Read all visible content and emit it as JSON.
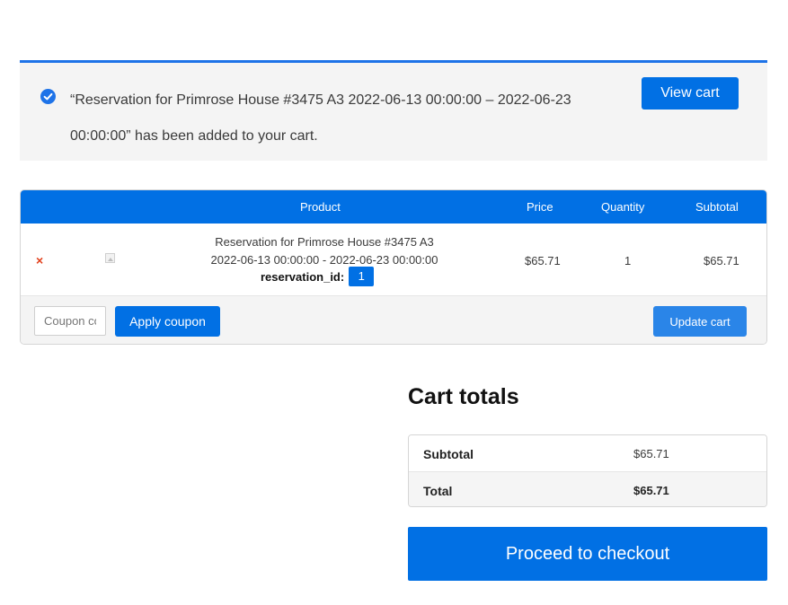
{
  "notice": {
    "message": "“Reservation for Primrose House #3475 A3 2022-06-13 00:00:00 – 2022-06-23 00:00:00” has been added to your cart.",
    "view_cart_label": "View cart",
    "icon": "check-circle-icon"
  },
  "cart_table": {
    "headers": {
      "product": "Product",
      "price": "Price",
      "quantity": "Quantity",
      "subtotal": "Subtotal"
    },
    "rows": [
      {
        "remove_symbol": "×",
        "product_line1": "Reservation for Primrose House #3475 A3",
        "product_line2": "2022-06-13 00:00:00 - 2022-06-23 00:00:00",
        "meta_key": "reservation_id:",
        "meta_value": "1",
        "price": "$65.71",
        "quantity": "1",
        "subtotal": "$65.71"
      }
    ],
    "coupon_placeholder": "Coupon code",
    "apply_coupon_label": "Apply coupon",
    "update_cart_label": "Update cart"
  },
  "cart_totals": {
    "title": "Cart totals",
    "subtotal_label": "Subtotal",
    "subtotal_value": "$65.71",
    "total_label": "Total",
    "total_value": "$65.71",
    "checkout_label": "Proceed to checkout"
  },
  "colors": {
    "accent": "#0170e4",
    "notice_bg": "#f4f4f4",
    "remove": "#e2401c"
  }
}
